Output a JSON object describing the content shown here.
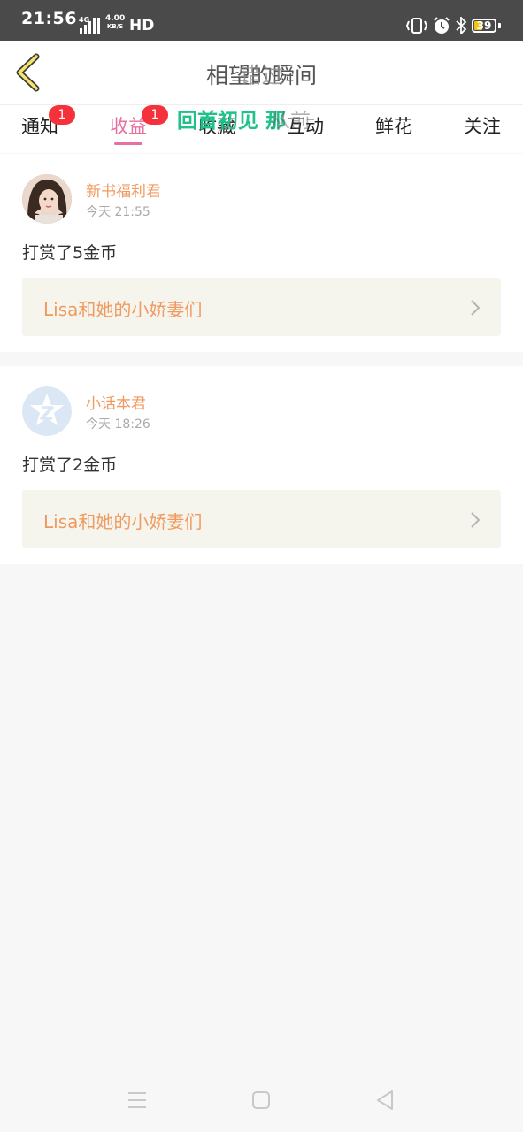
{
  "status_bar": {
    "time": "21:56",
    "signal_label": "4G",
    "speed_value": "4.00",
    "speed_unit": "KB/S",
    "hd_label": "HD",
    "battery_level": "39",
    "battery_fraction": 0.39,
    "icons": [
      "signal-icon",
      "vibrate-icon",
      "alarm-icon",
      "bluetooth-icon",
      "battery-icon"
    ]
  },
  "header": {
    "title": "相望的瞬间",
    "title_overlay": "错过",
    "back_icon": "chevron-left-icon"
  },
  "tabs": [
    {
      "label": "通知",
      "badge": "1",
      "active": false
    },
    {
      "label": "收益",
      "badge": "1",
      "active": true
    },
    {
      "label": "收藏",
      "badge": "",
      "active": false
    },
    {
      "label": "互动",
      "badge": "",
      "active": false
    },
    {
      "label": "鲜花",
      "badge": "",
      "active": false
    },
    {
      "label": "关注",
      "badge": "",
      "active": false
    }
  ],
  "floating_text": {
    "main": "回首初见 那",
    "ghost": "从前"
  },
  "items": [
    {
      "sender": "新书福利君",
      "time": "今天 21:55",
      "message": "打赏了5金币",
      "book_title": "Lisa和她的小娇妻们",
      "avatar": "photo"
    },
    {
      "sender": "小话本君",
      "time": "今天 18:26",
      "message": "打赏了2金币",
      "book_title": "Lisa和她的小娇妻们",
      "avatar": "logo"
    }
  ],
  "nav_bar": {
    "icons": [
      "menu-icon",
      "home-icon",
      "back-triangle-icon"
    ]
  },
  "colors": {
    "accent_pink": "#e86fa0",
    "accent_orange": "#f09a60",
    "badge_red": "#f5323c",
    "floating_green": "#22c08a",
    "status_bar_bg": "#4a4a4a",
    "back_icon_yellow": "#f3e46a"
  }
}
